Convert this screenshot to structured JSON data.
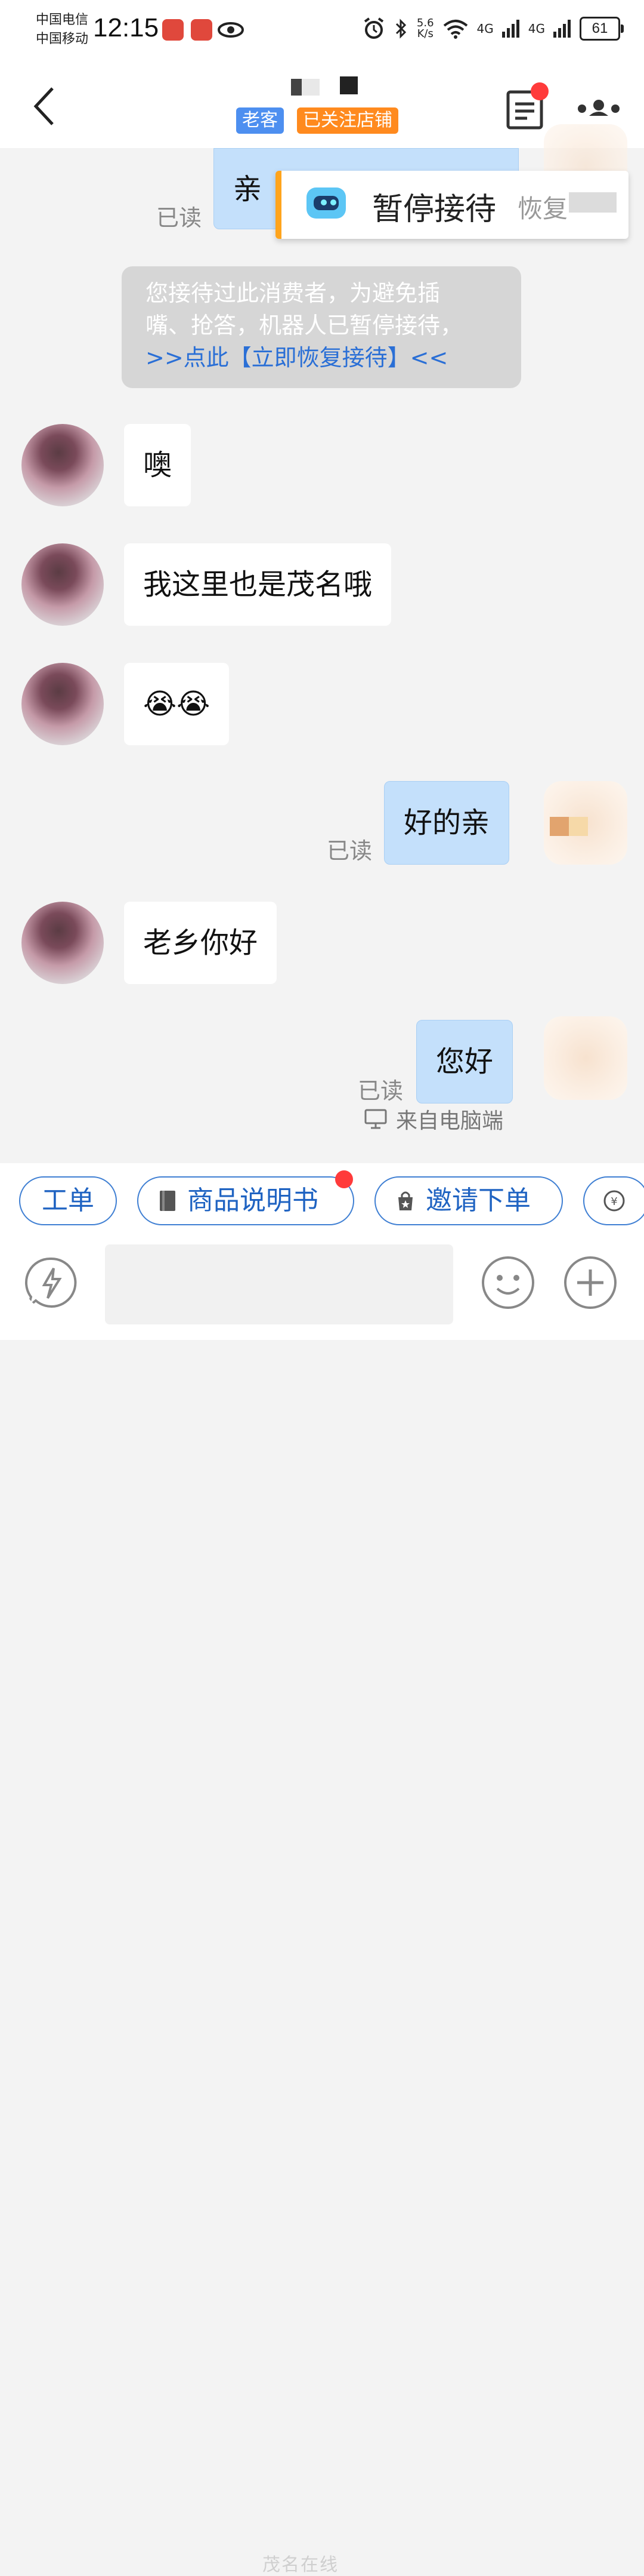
{
  "status_bar": {
    "carrier1": "中国电信",
    "carrier2": "中国移动",
    "time": "12:15",
    "net_speed": "5.6",
    "net_speed_unit": "K/s",
    "sig1": "4G",
    "sig2": "4G",
    "battery": "61"
  },
  "header": {
    "tag_old_customer": "老客",
    "tag_followed_shop": "已关注店铺"
  },
  "robot_popup": {
    "pause_label": "暂停接待",
    "restore_label": "恢复"
  },
  "notice": {
    "line1": "您接待过此消费者，为避免插",
    "line2": "嘴、抢答，机器人已暂停接待，",
    "link": ">>点此【立即恢复接待】<<"
  },
  "messages": [
    {
      "direction": "out",
      "text": "亲",
      "status": "已读"
    },
    {
      "direction": "in",
      "text": "噢"
    },
    {
      "direction": "in",
      "text": "我这里也是茂名哦"
    },
    {
      "direction": "in",
      "text": "😭😭"
    },
    {
      "direction": "out",
      "text": "好的亲",
      "status": "已读"
    },
    {
      "direction": "in",
      "text": "老乡你好"
    },
    {
      "direction": "out",
      "text": "您好",
      "status": "已读"
    }
  ],
  "from_pc": "来自电脑端",
  "quick_actions": [
    {
      "label": "工单"
    },
    {
      "label": "商品说明书"
    },
    {
      "label": "邀请下单"
    }
  ],
  "watermark": "茂名在线"
}
